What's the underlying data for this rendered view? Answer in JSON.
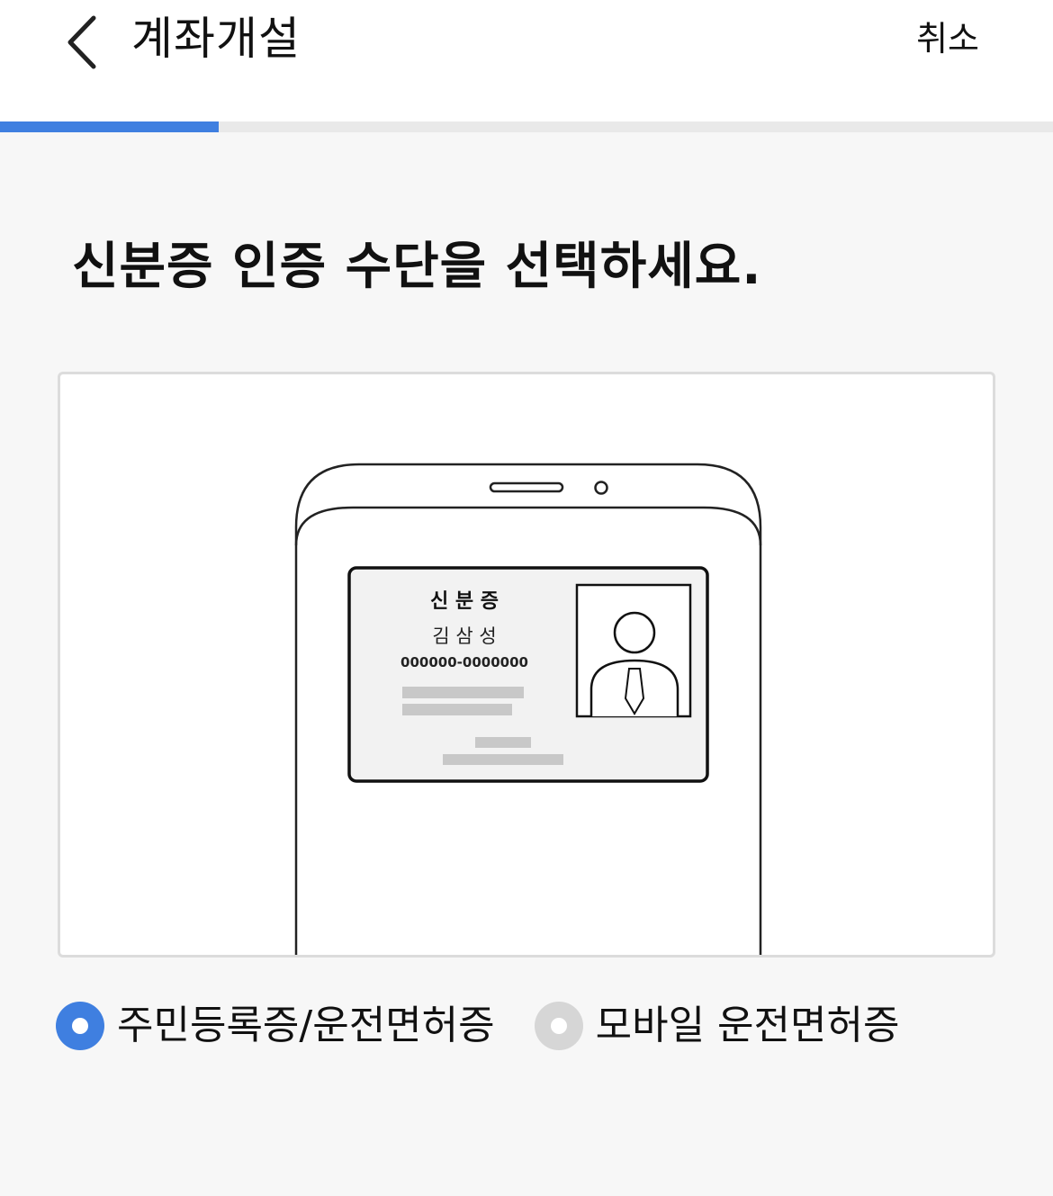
{
  "header": {
    "title": "계좌개설",
    "cancel_label": "취소"
  },
  "progress": {
    "fraction": 0.208
  },
  "main": {
    "headline": "신분증 인증 수단을 선택하세요."
  },
  "id_card": {
    "title": "신 분 증",
    "name": "김 삼 성",
    "number": "000000-0000000"
  },
  "options": [
    {
      "label": "주민등록증/운전면허증",
      "checked": true
    },
    {
      "label": "모바일 운전면허증",
      "checked": false
    }
  ],
  "colors": {
    "accent": "#3f7fe0",
    "radio_unchecked": "#d6d6d6",
    "placeholder_bar": "#c8c8c8"
  }
}
